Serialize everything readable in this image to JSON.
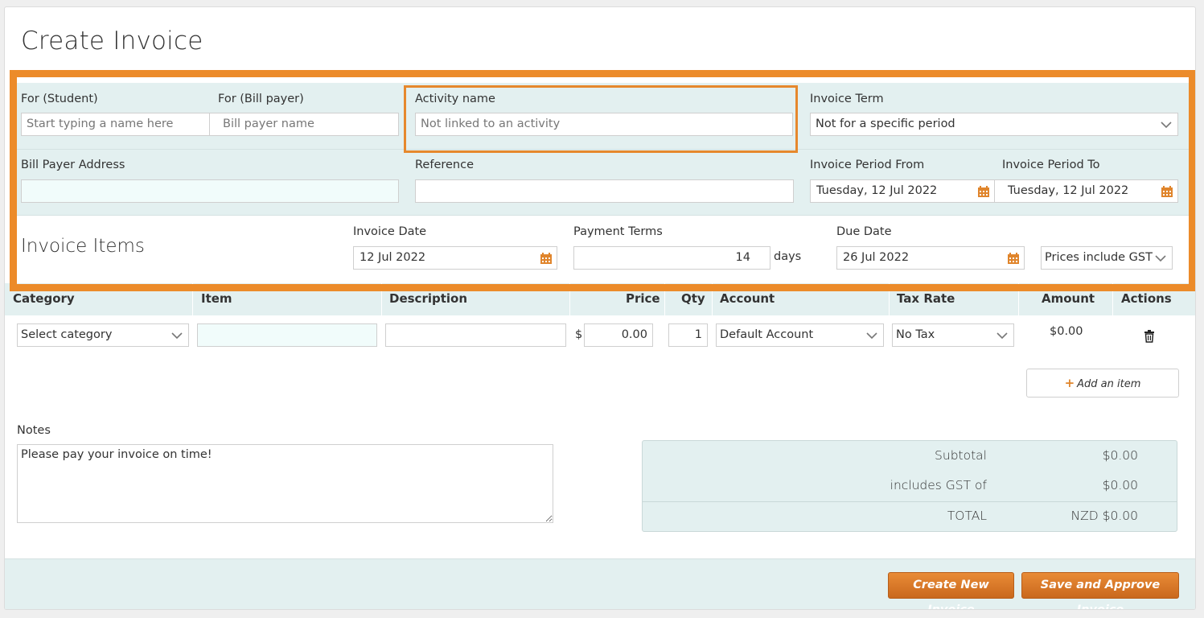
{
  "page": {
    "title": "Create Invoice"
  },
  "form": {
    "student": {
      "label": "For (Student)",
      "placeholder": "Start typing a name here"
    },
    "billpayer": {
      "label": "For (Bill payer)",
      "placeholder": "Bill payer name"
    },
    "activity": {
      "label": "Activity name",
      "placeholder": "Not linked to an activity"
    },
    "term": {
      "label": "Invoice Term",
      "value": "Not for a specific period"
    },
    "address": {
      "label": "Bill Payer Address",
      "value": ""
    },
    "reference": {
      "label": "Reference",
      "value": ""
    },
    "period_from": {
      "label": "Invoice Period From",
      "value": "Tuesday, 12 Jul 2022"
    },
    "period_to": {
      "label": "Invoice Period To",
      "value": "Tuesday, 12 Jul 2022"
    }
  },
  "items_section": {
    "title": "Invoice Items",
    "invoice_date": {
      "label": "Invoice Date",
      "value": "12 Jul 2022"
    },
    "payment_terms": {
      "label": "Payment Terms",
      "value": "14",
      "unit": "days"
    },
    "due_date": {
      "label": "Due Date",
      "value": "26 Jul 2022"
    },
    "gst_mode": "Prices include GST"
  },
  "table": {
    "headers": {
      "category": "Category",
      "item": "Item",
      "description": "Description",
      "price": "Price",
      "qty": "Qty",
      "account": "Account",
      "tax_rate": "Tax Rate",
      "amount": "Amount",
      "actions": "Actions"
    },
    "row": {
      "category": "Select category",
      "item": "",
      "description": "",
      "currency": "$",
      "price": "0.00",
      "qty": "1",
      "account": "Default Account",
      "tax_rate": "No Tax",
      "amount": "$0.00"
    },
    "add_item_label": "Add an item"
  },
  "notes": {
    "label": "Notes",
    "value": "Please pay your invoice on time!"
  },
  "totals": {
    "subtotal_label": "Subtotal",
    "subtotal_value": "$0.00",
    "gst_label": "includes GST of",
    "gst_value": "$0.00",
    "total_label": "TOTAL",
    "total_value": "NZD $0.00"
  },
  "buttons": {
    "create": "Create New Invoice",
    "approve": "Save and Approve Invoice"
  },
  "colors": {
    "accent": "#ec8b2a",
    "band": "#e3f0f0",
    "mint": "#f1fcfb"
  }
}
